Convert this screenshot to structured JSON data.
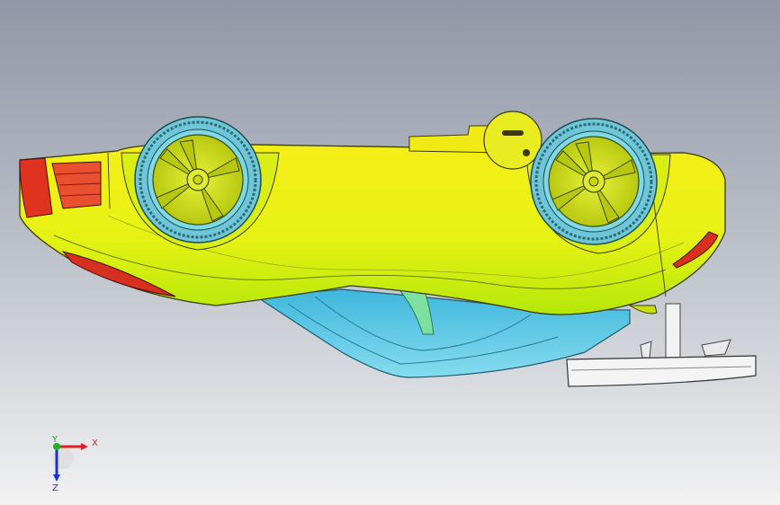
{
  "viewport": {
    "background_top": "#8f97a6",
    "background_bottom": "#f2f2f3"
  },
  "model": {
    "body_color_top": "#f2ea14",
    "body_color_bottom": "#c4ef0c",
    "taillight_color": "#e0321e",
    "glass_color": "#4fc8e8",
    "wheel_rim_color": "#d2e014",
    "tire_color": "#7ed0dc",
    "part_color": "#f2f2f2"
  },
  "triad": {
    "x_label": "X",
    "y_label": "Y",
    "z_label": "Z",
    "x_color": "#e02020",
    "y_color": "#20b020",
    "z_color": "#2030d0"
  }
}
